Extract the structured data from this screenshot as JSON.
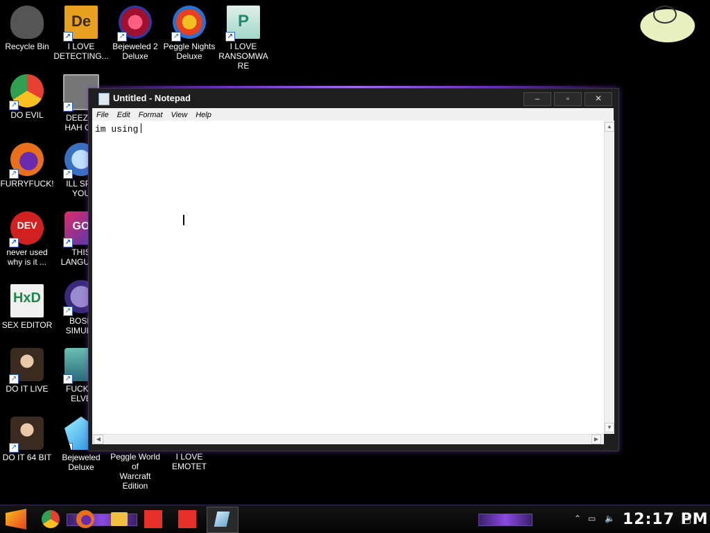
{
  "desktop": {
    "icons": [
      {
        "label": "Recycle Bin",
        "icon": "recycle-bin-icon",
        "color": "#666666",
        "shortcut": false
      },
      {
        "label": "I LOVE\nDETECTING...",
        "icon": "de-app-icon",
        "color": "#e8a020",
        "shortcut": true
      },
      {
        "label": "Bejeweled 2\nDeluxe",
        "icon": "bejeweled-2-icon",
        "color": "#c0203a",
        "shortcut": true
      },
      {
        "label": "Peggle Nights\nDeluxe",
        "icon": "peggle-icon",
        "color": "#2a70d0",
        "shortcut": true
      },
      {
        "label": "I LOVE\nRANSOMWARE",
        "icon": "publisher-icon",
        "color": "#1f8a70",
        "shortcut": true
      },
      {
        "label": "DO EVIL",
        "icon": "chrome-icon",
        "color": "#e84030",
        "shortcut": true
      },
      {
        "label": "DEEZ N\nHAH GO",
        "icon": "windows-stack-icon",
        "color": "#888888",
        "shortcut": true
      },
      {
        "label": "FURRYFUCK!",
        "icon": "firefox-icon",
        "color": "#e8701a",
        "shortcut": true
      },
      {
        "label": "ILL SPY\nYOU",
        "icon": "network-spy-icon",
        "color": "#5aa0e0",
        "shortcut": true
      },
      {
        "label": "never used\nwhy is it ...",
        "icon": "dev-cpp-icon",
        "color": "#d02020",
        "shortcut": true
      },
      {
        "label": "THIS\nLANGUAG",
        "icon": "go-language-icon",
        "color": "#4a3ab0",
        "shortcut": true
      },
      {
        "label": "SEX EDITOR",
        "icon": "hxd-editor-icon",
        "color": "#e8e8e8",
        "shortcut": false
      },
      {
        "label": "BOSN\nSIMULA",
        "icon": "bosnia-sim-icon",
        "color": "#4a3a8a",
        "shortcut": true
      },
      {
        "label": "DO IT LIVE",
        "icon": "portrait-icon",
        "color": "#8a6a50",
        "shortcut": true
      },
      {
        "label": "FUCK S\nELVE",
        "icon": "elves-game-icon",
        "color": "#3a8a8a",
        "shortcut": true
      },
      {
        "label": "DO IT 64 BIT",
        "icon": "portrait-64-icon",
        "color": "#8a6a50",
        "shortcut": true
      },
      {
        "label": "Bejeweled\nDeluxe",
        "icon": "bejeweled-gem-icon",
        "color": "#20a0e0",
        "shortcut": true
      },
      {
        "label": "Peggle World of\nWarcraft Edition",
        "icon": "",
        "color": "",
        "shortcut": false
      },
      {
        "label": "I LOVE EMOTET",
        "icon": "",
        "color": "",
        "shortcut": false
      }
    ]
  },
  "notepad": {
    "title": "Untitled - Notepad",
    "menu": [
      "File",
      "Edit",
      "Format",
      "View",
      "Help"
    ],
    "content": "im using",
    "buttons": {
      "minimize": "–",
      "maximize": "▫",
      "close": "✕"
    }
  },
  "taskbar": {
    "clock": "12:17 PM",
    "items": [
      "start-menu-icon",
      "chrome-taskbar-icon",
      "firefox-taskbar-icon",
      "file-explorer-icon",
      "anydesk-icon-1",
      "anydesk-icon-2",
      "notepad-taskbar-icon"
    ]
  }
}
